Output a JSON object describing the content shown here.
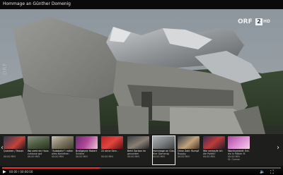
{
  "window": {
    "title": "Hommage an Günther Domenig"
  },
  "channel": {
    "logo": "ORF",
    "number": "2",
    "hd": "HD",
    "side_watermark": "ORF"
  },
  "playlist": [
    {
      "title": "Quecken / Teaser",
      "sub": "",
      "duration": "00:00 MIN"
    },
    {
      "title": "Wo sieht ein Haus",
      "sub": "zuhause gut",
      "duration": "00:00 MIN"
    },
    {
      "title": "\"Autobahn\": rollen",
      "sub": "alles Korinthen",
      "duration": "00:00 MIN"
    },
    {
      "title": "Bratlgeyst: Robert",
      "sub": "Schöne",
      "duration": "00:00 MIN"
    },
    {
      "title": "22 ohne Sinn -",
      "sub": "",
      "duration": "00:00 MIN"
    },
    {
      "title": "Betti Gorban im",
      "sub": "gesunden",
      "duration": "00:00 MIN"
    },
    {
      "title": "Hommage an Gün-",
      "sub": "ther Domenig",
      "duration": "00:00 MIN"
    },
    {
      "title": "Ohne Zahl: Rumpf",
      "sub": "Ruppig",
      "duration": "00:00 MIN"
    },
    {
      "title": "Wie verkaufe ich",
      "sub": "die Politik?",
      "duration": "00:00 MIN"
    },
    {
      "title": "Wachsamkeit: Ent-",
      "sub": "ein is Plötze: R.",
      "duration": "00:00 MIN",
      "extra": "St. Carnox"
    }
  ],
  "player": {
    "current_time": "00:00 / 00:00:00",
    "progress": 0.35,
    "accent": "#e8322d"
  },
  "icons": {
    "play": "play-icon",
    "volume": "volume-icon",
    "fullscreen": "fullscreen-icon",
    "prev": "chevron-left-icon",
    "next": "chevron-right-icon"
  }
}
